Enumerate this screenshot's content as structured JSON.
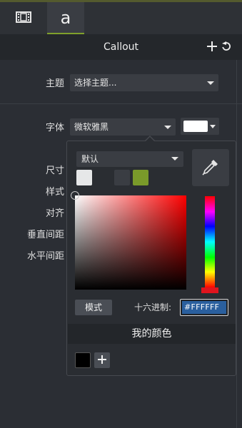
{
  "tabs": [
    {
      "name": "media",
      "icon": "film-icon"
    },
    {
      "name": "annotations",
      "label": "a"
    }
  ],
  "header": {
    "title": "Callout"
  },
  "properties": {
    "theme_label": "主题",
    "theme_value": "选择主题...",
    "font_label": "字体",
    "font_value": "微软雅黑",
    "size_label": "尺寸",
    "style_label": "样式",
    "align_label": "对齐",
    "line_spacing_label": "垂直间距",
    "char_spacing_label": "水平间距",
    "font_color": "#FFFFFF"
  },
  "color_picker": {
    "preset_value": "默认",
    "swatches": [
      "#e6e7e8",
      "#3a3d43",
      "#7a9a2a"
    ],
    "mode_button": "模式",
    "hex_label": "十六进制:",
    "hex_value": "#FFFFFF",
    "my_colors_title": "我的颜色",
    "my_colors": [
      "#000000"
    ]
  }
}
